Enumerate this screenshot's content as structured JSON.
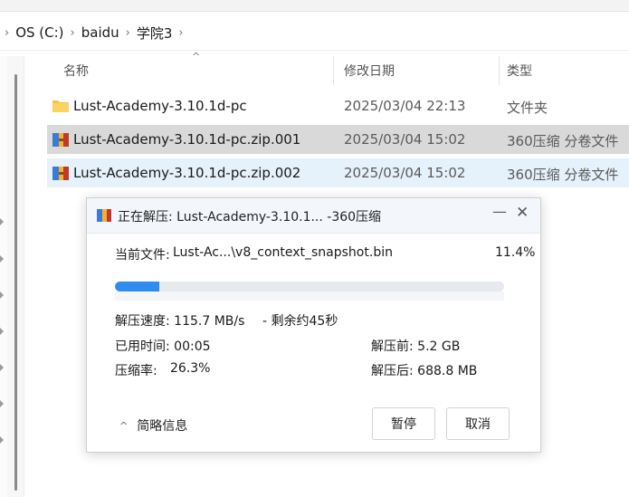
{
  "breadcrumb": {
    "items": [
      "OS (C:)",
      "baidu",
      "学院3"
    ]
  },
  "columns": {
    "name": "名称",
    "modified": "修改日期",
    "type": "类型"
  },
  "files": [
    {
      "name": "Lust-Academy-3.10.1d-pc",
      "date": "2025/03/04 22:13",
      "type": "文件夹",
      "icon": "folder-icon"
    },
    {
      "name": "Lust-Academy-3.10.1d-pc.zip.001",
      "date": "2025/03/04 15:02",
      "type": "360压缩 分卷文件",
      "icon": "archive-icon"
    },
    {
      "name": "Lust-Academy-3.10.1d-pc.zip.002",
      "date": "2025/03/04 15:02",
      "type": "360压缩 分卷文件",
      "icon": "archive-icon"
    }
  ],
  "dialog": {
    "title": "正在解压: Lust-Academy-3.10.1... -360压缩",
    "current_file_label": "当前文件:",
    "current_file": "Lust-Ac...\\v8_context_snapshot.bin",
    "percent_text": "11.4%",
    "progress": 0.114,
    "speed": "解压速度: 115.7 MB/s",
    "remaining": "- 剩余约45秒",
    "elapsed": "已用时间: 00:05",
    "ratio_label": "压缩率:",
    "ratio_value": "26.3%",
    "before": "解压前: 5.2 GB",
    "after": "解压后: 688.8 MB",
    "collapse_label": "简略信息",
    "pause_label": "暂停",
    "cancel_label": "取消"
  },
  "colors": {
    "accent": "#2f8cf0",
    "selected_row": "#d9d9d9",
    "hover_row": "#e5f1fb",
    "folder": "#f6c344"
  }
}
